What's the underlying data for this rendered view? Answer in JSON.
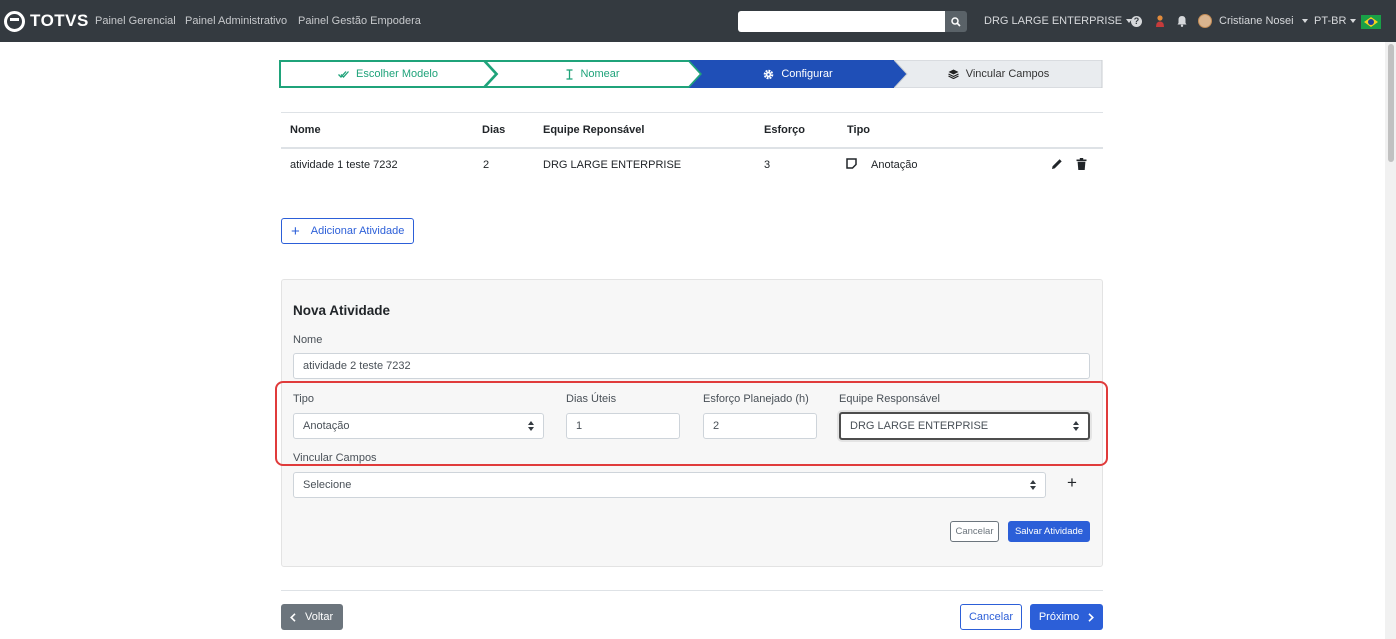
{
  "navbar": {
    "brand": "TOTVS",
    "links": [
      "Painel Gerencial",
      "Painel Administrativo",
      "Painel Gestão Empodera"
    ],
    "search": {
      "value": "",
      "placeholder": ""
    },
    "company": "DRG LARGE ENTERPRISE",
    "user_name": "Cristiane Nosei",
    "language": "PT-BR"
  },
  "stepper": {
    "steps": [
      {
        "label": "Escolher Modelo",
        "state": "done",
        "icon": "double-check-icon"
      },
      {
        "label": "Nomear",
        "state": "done",
        "icon": "text-cursor-icon"
      },
      {
        "label": "Configurar",
        "state": "active",
        "icon": "gear-icon"
      },
      {
        "label": "Vincular Campos",
        "state": "pending",
        "icon": "layers-icon"
      }
    ]
  },
  "table": {
    "headers": {
      "name": "Nome",
      "days": "Dias",
      "team": "Equipe Reponsável",
      "effort": "Esforço",
      "type": "Tipo"
    },
    "rows": [
      {
        "name": "atividade 1 teste 7232",
        "days": "2",
        "team": "DRG LARGE ENTERPRISE",
        "effort": "3",
        "type": "Anotação"
      }
    ]
  },
  "add_activity_label": "Adicionar Atividade",
  "form": {
    "title": "Nova Atividade",
    "name_label": "Nome",
    "name_value": "atividade 2 teste 7232",
    "type_label": "Tipo",
    "type_value": "Anotação",
    "days_label": "Dias Úteis",
    "days_value": "1",
    "effort_label": "Esforço Planejado (h)",
    "effort_value": "2",
    "team_label": "Equipe Responsável",
    "team_value": "DRG LARGE ENTERPRISE",
    "fields_label": "Vincular Campos",
    "fields_value": "Selecione",
    "cancel_label": "Cancelar",
    "save_label": "Salvar Atividade"
  },
  "footer": {
    "back_label": "Voltar",
    "cancel_label": "Cancelar",
    "next_label": "Próximo"
  },
  "colors": {
    "navbar": "#343a40",
    "primary": "#2c5fd8",
    "step_done": "#1fa37a",
    "step_active": "#1f4fb7",
    "step_pending": "#e9ecef",
    "highlight": "#e03b3b"
  }
}
